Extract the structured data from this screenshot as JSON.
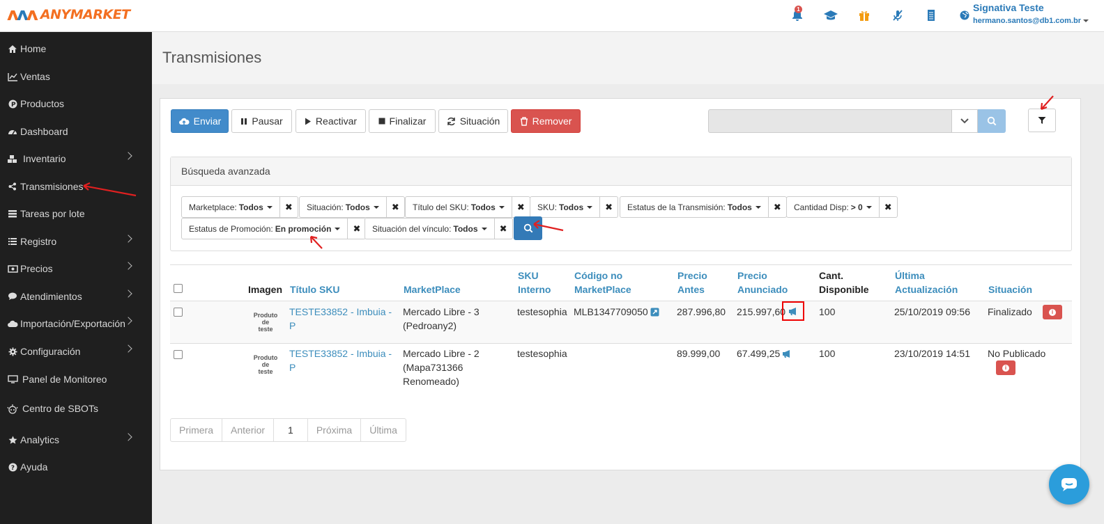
{
  "brand": {
    "logo_text": "ANYMARKET"
  },
  "user": {
    "name": "Signativa Teste",
    "email": "hermano.santos@db1.com.br"
  },
  "notifications": {
    "count": "1"
  },
  "top_icons": [
    "bell-icon",
    "graduation-cap-icon",
    "gift-icon",
    "microphone-slash-icon",
    "document-icon",
    "globe-icon"
  ],
  "sidebar": {
    "items": [
      {
        "label": "Home",
        "icon": "home-icon",
        "has_submenu": false
      },
      {
        "label": "Ventas",
        "icon": "line-chart-icon",
        "has_submenu": false
      },
      {
        "label": "Productos",
        "icon": "product-icon",
        "has_submenu": false
      },
      {
        "label": "Dashboard",
        "icon": "dashboard-icon",
        "has_submenu": false
      },
      {
        "label": "Inventario",
        "icon": "cubes-icon",
        "has_submenu": true
      },
      {
        "label": "Transmisiones",
        "icon": "share-icon",
        "has_submenu": false
      },
      {
        "label": "Tareas por lote",
        "icon": "list-icon",
        "has_submenu": false
      },
      {
        "label": "Registro",
        "icon": "list-ul-icon",
        "has_submenu": true
      },
      {
        "label": "Precios",
        "icon": "money-icon",
        "has_submenu": true
      },
      {
        "label": "Atendimientos",
        "icon": "comment-icon",
        "has_submenu": true
      },
      {
        "label": "Importación/Exportación",
        "icon": "cloud-icon",
        "has_submenu": true
      },
      {
        "label": "Configuración",
        "icon": "gear-icon",
        "has_submenu": true
      },
      {
        "label": "Panel de Monitoreo",
        "icon": "monitor-icon",
        "has_submenu": false
      },
      {
        "label": "Centro de SBOTs",
        "icon": "robot-icon",
        "has_submenu": false
      },
      {
        "label": "Analytics",
        "icon": "star-icon",
        "has_submenu": true
      },
      {
        "label": "Ayuda",
        "icon": "question-icon",
        "has_submenu": false
      }
    ]
  },
  "page": {
    "title": "Transmisiones"
  },
  "toolbar": {
    "enviar": "Enviar",
    "pausar": "Pausar",
    "reactivar": "Reactivar",
    "finalizar": "Finalizar",
    "situacion": "Situación",
    "remover": "Remover",
    "search_value": ""
  },
  "advanced_search": {
    "title": "Búsqueda avanzada",
    "filters": [
      {
        "label": "Marketplace:",
        "value": "Todos"
      },
      {
        "label": "Situación:",
        "value": "Todos"
      },
      {
        "label": "Título del SKU:",
        "value": "Todos"
      },
      {
        "label": "SKU:",
        "value": "Todos"
      },
      {
        "label": "Estatus de la Transmisión:",
        "value": "Todos"
      },
      {
        "label": "Cantidad Disp:",
        "value": "> 0"
      },
      {
        "label": "Estatus de Promoción:",
        "value": "En promoción"
      },
      {
        "label": "Situación del vínculo:",
        "value": "Todos"
      }
    ]
  },
  "table": {
    "headers": {
      "imagen": "Imagen",
      "titulo": "Título SKU",
      "marketplace": "MarketPlace",
      "sku_l1": "SKU",
      "sku_l2": "Interno",
      "codigo_l1": "Código no",
      "codigo_l2": "MarketPlace",
      "precio_antes_l1": "Precio",
      "precio_antes_l2": "Antes",
      "precio_anun_l1": "Precio",
      "precio_anun_l2": "Anunciado",
      "cant_l1": "Cant.",
      "cant_l2": "Disponible",
      "ultima_l1": "Última",
      "ultima_l2": "Actualización",
      "situacion": "Situación"
    },
    "rows": [
      {
        "thumb_l1": "Produto",
        "thumb_l2": "de",
        "thumb_l3": "teste",
        "titulo_l1": "TESTE33852 - Imbuia -",
        "titulo_l2": "P",
        "mp_l1": "Mercado Libre - 3",
        "mp_l2": "(Pedroany2)",
        "mp_l3": "",
        "sku": "testesophia",
        "codigo": "MLB1347709050",
        "precio_antes": "287.996,80",
        "precio_anun": "215.997,60",
        "cant": "100",
        "ultima": "25/10/2019 09:56",
        "situacion": "Finalizado"
      },
      {
        "thumb_l1": "Produto",
        "thumb_l2": "de",
        "thumb_l3": "teste",
        "titulo_l1": "TESTE33852 - Imbuia -",
        "titulo_l2": "P",
        "mp_l1": "Mercado Libre - 2",
        "mp_l2": "(Mapa731366",
        "mp_l3": "Renomeado)",
        "sku": "testesophia",
        "codigo": "",
        "precio_antes": "89.999,00",
        "precio_anun": "67.499,25",
        "cant": "100",
        "ultima": "23/10/2019 14:51",
        "situacion": "No Publicado"
      }
    ]
  },
  "pagination": {
    "first": "Primera",
    "prev": "Anterior",
    "current": "1",
    "next": "Próxima",
    "last": "Última"
  },
  "colors": {
    "primary": "#428bca",
    "danger": "#d9534f",
    "sidebar": "#1f1f1f",
    "link": "#3c8dbc",
    "brand_orange": "#f36f21"
  }
}
